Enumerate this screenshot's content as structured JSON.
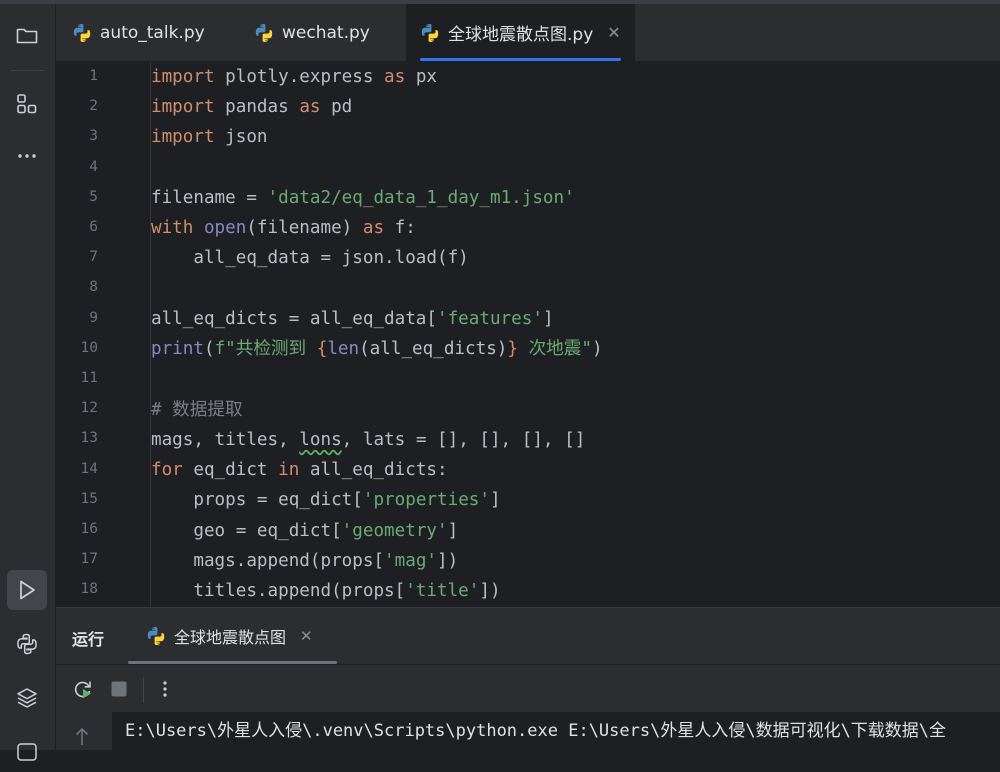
{
  "tabs": [
    {
      "label": "auto_talk.py",
      "active": false
    },
    {
      "label": "wechat.py",
      "active": false
    },
    {
      "label": "全球地震散点图.py",
      "active": true
    }
  ],
  "line_numbers": [
    "1",
    "2",
    "3",
    "4",
    "5",
    "6",
    "7",
    "8",
    "9",
    "10",
    "11",
    "12",
    "13",
    "14",
    "15",
    "16",
    "17",
    "18"
  ],
  "code": {
    "l1": {
      "kw1": "import",
      "t1": " plotly.express ",
      "kw2": "as",
      "t2": " px"
    },
    "l2": {
      "kw1": "import",
      "t1": " pandas ",
      "kw2": "as",
      "t2": " pd"
    },
    "l3": {
      "kw1": "import",
      "t1": " json"
    },
    "l5": {
      "t1": "filename = ",
      "s1": "'data2/eq_data_1_day_m1.json'"
    },
    "l6": {
      "kw1": "with",
      "sp": " ",
      "b1": "open",
      "t1": "(filename) ",
      "kw2": "as",
      "t2": " f:"
    },
    "l7": {
      "t1": "    all_eq_data = json.load(f)"
    },
    "l9": {
      "t1": "all_eq_dicts = all_eq_data[",
      "s1": "'features'",
      "t2": "]"
    },
    "l10": {
      "b1": "print",
      "t1": "(",
      "s1": "f\"共检测到 ",
      "kw1": "{",
      "b2": "len",
      "t2": "(all_eq_dicts)",
      "kw2": "}",
      "s2": " 次地震\"",
      "t3": ")"
    },
    "l12": {
      "c1": "# 数据提取"
    },
    "l13": {
      "t1": "mags, titles, ",
      "sq": "lons",
      "t2": ", lats = [], [], [], []"
    },
    "l14": {
      "kw1": "for",
      "t1": " eq_dict ",
      "kw2": "in",
      "t2": " all_eq_dicts:"
    },
    "l15": {
      "t1": "    props = eq_dict[",
      "s1": "'properties'",
      "t2": "]"
    },
    "l16": {
      "t1": "    geo = eq_dict[",
      "s1": "'geometry'",
      "t2": "]"
    },
    "l17": {
      "t1": "    mags.append(props[",
      "s1": "'mag'",
      "t2": "])"
    },
    "l18": {
      "t1": "    titles.append(props[",
      "s1": "'title'",
      "t2": "])"
    }
  },
  "run_panel": {
    "title": "运行",
    "tab_label": "全球地震散点图",
    "console_line": "E:\\Users\\外星人入侵\\.venv\\Scripts\\python.exe E:\\Users\\外星人入侵\\数据可视化\\下载数据\\全"
  },
  "colors": {
    "accent": "#3574f0",
    "keyword": "#cf8e6d",
    "string": "#6aab73",
    "builtin": "#8888c6"
  }
}
